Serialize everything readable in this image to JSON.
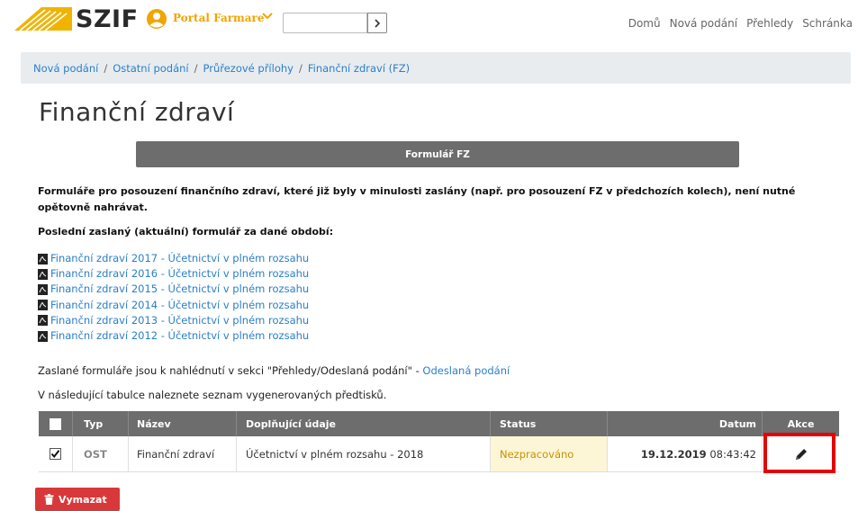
{
  "header": {
    "logo_text": "SZIF",
    "portal_label": "Portal Farmare",
    "search": {
      "value": "",
      "placeholder": ""
    },
    "nav": [
      "Domů",
      "Nová podání",
      "Přehledy",
      "Schránka"
    ]
  },
  "breadcrumb": [
    "Nová podání",
    "Ostatní podání",
    "Průřezové přílohy",
    "Finanční zdraví (FZ)"
  ],
  "page_title": "Finanční zdraví",
  "form_bar_label": "Formulář FZ",
  "intro_text": "Formuláře pro posouzení finančního zdraví, které již byly v minulosti zaslány (např. pro posouzení FZ v předchozích kolech), není nutné opětovně nahrávat.",
  "last_sent_label": "Poslední zaslaný (aktuální) formulář za dané období:",
  "files": [
    "Finanční zdraví 2017 - Účetnictví v plném rozsahu",
    "Finanční zdraví 2016 - Účetnictví v plném rozsahu",
    "Finanční zdraví 2015 - Účetnictví v plném rozsahu",
    "Finanční zdraví 2014 - Účetnictví v plném rozsahu",
    "Finanční zdraví 2013 - Účetnictví v plném rozsahu",
    "Finanční zdraví 2012 - Účetnictví v plném rozsahu"
  ],
  "sent_text": "Zaslané formuláře jsou k nahlédnutí v sekci \"Přehledy/Odeslaná podání\" - ",
  "sent_link": "Odeslaná podání",
  "table_intro": "V následující tabulce naleznete seznam vygenerovaných předtisků.",
  "table": {
    "columns": [
      "Typ",
      "Název",
      "Doplňující údaje",
      "Status",
      "Datum",
      "Akce"
    ],
    "rows": [
      {
        "checked": true,
        "typ": "OST",
        "nazev": "Finanční zdraví",
        "doplnujici": "Účetnictví v plném rozsahu - 2018",
        "status": "Nezpracováno",
        "datum_date": "19.12.2019",
        "datum_time": "08:43:42"
      }
    ]
  },
  "delete_label": "Vymazat",
  "colors": {
    "accent": "#f0a500",
    "link": "#2a7fc9",
    "header_bar": "#6d6d6d",
    "danger": "#d9383a",
    "highlight": "#e60000"
  }
}
